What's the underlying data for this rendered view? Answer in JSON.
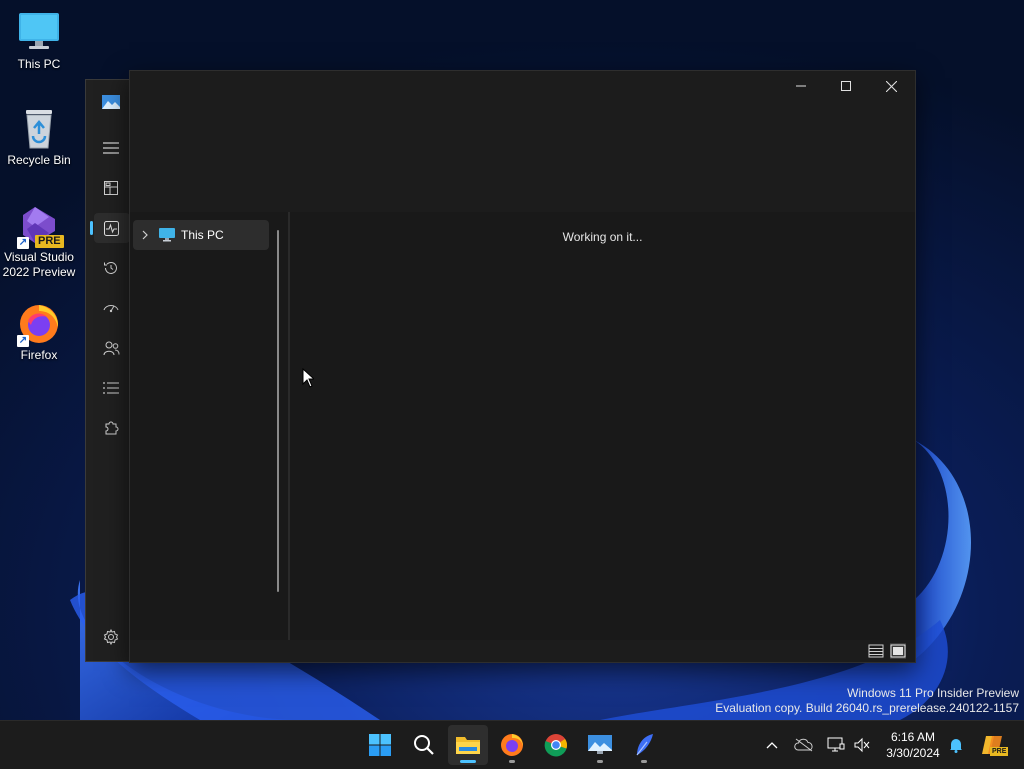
{
  "desktop": {
    "icons": [
      {
        "label": "This PC"
      },
      {
        "label": "Recycle Bin"
      },
      {
        "label": "Visual Studio 2022 Preview",
        "line1": "Visual Studio",
        "line2": "2022 Preview",
        "badge": "PRE"
      },
      {
        "label": "Firefox"
      }
    ]
  },
  "explorer": {
    "nav": {
      "this_pc": "This PC"
    },
    "status_message": "Working on it..."
  },
  "sidebar_icons": [
    "gallery-icon",
    "hamburger-menu-icon",
    "dashboard-icon",
    "activity-icon",
    "history-icon",
    "performance-icon",
    "users-icon",
    "list-icon",
    "extension-icon",
    "settings-icon"
  ],
  "watermark": {
    "line1": "Windows 11 Pro Insider Preview",
    "line2": "Evaluation copy. Build 26040.rs_prerelease.240122-1157"
  },
  "taskbar": {
    "apps": [
      "start-icon",
      "search-icon",
      "file-explorer-icon",
      "firefox-icon",
      "chrome-icon",
      "monitor-app-icon",
      "feather-app-icon"
    ],
    "time": "6:16 AM",
    "date": "3/30/2024",
    "copilot_badge": "PRE"
  },
  "colors": {
    "accent": "#4cc2ff",
    "window_bg": "#1c1c1c",
    "taskbar_bg": "#1c1c1c"
  }
}
